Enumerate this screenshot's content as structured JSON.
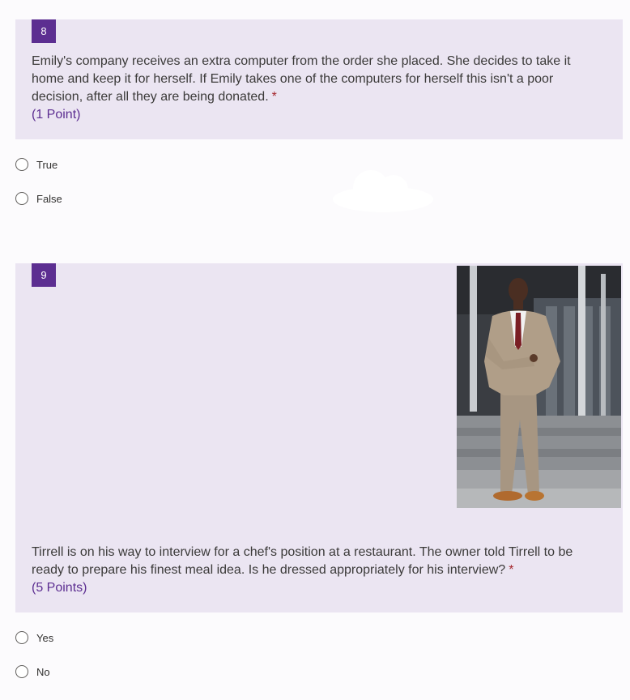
{
  "questions": [
    {
      "number": "8",
      "text": "Emily's company receives an extra computer from the order she placed. She decides to take it home and keep it for herself. If Emily takes one of the computers for herself this isn't a poor decision, after all they are being donated.",
      "required_mark": "*",
      "points": "(1 Point)",
      "options": [
        "True",
        "False"
      ]
    },
    {
      "number": "9",
      "text": "Tirrell is on his way to interview for a chef's position at a restaurant. The owner told Tirrell to be ready to prepare his finest meal idea. Is he dressed appropriately for his interview?",
      "required_mark": "*",
      "points": "(5 Points)",
      "options": [
        "Yes",
        "No"
      ]
    }
  ],
  "colors": {
    "accent": "#5c2e91",
    "header_bg": "#ebe5f2",
    "required": "#a4262c"
  },
  "icons": {
    "option_marker": "radio-circle-icon"
  }
}
